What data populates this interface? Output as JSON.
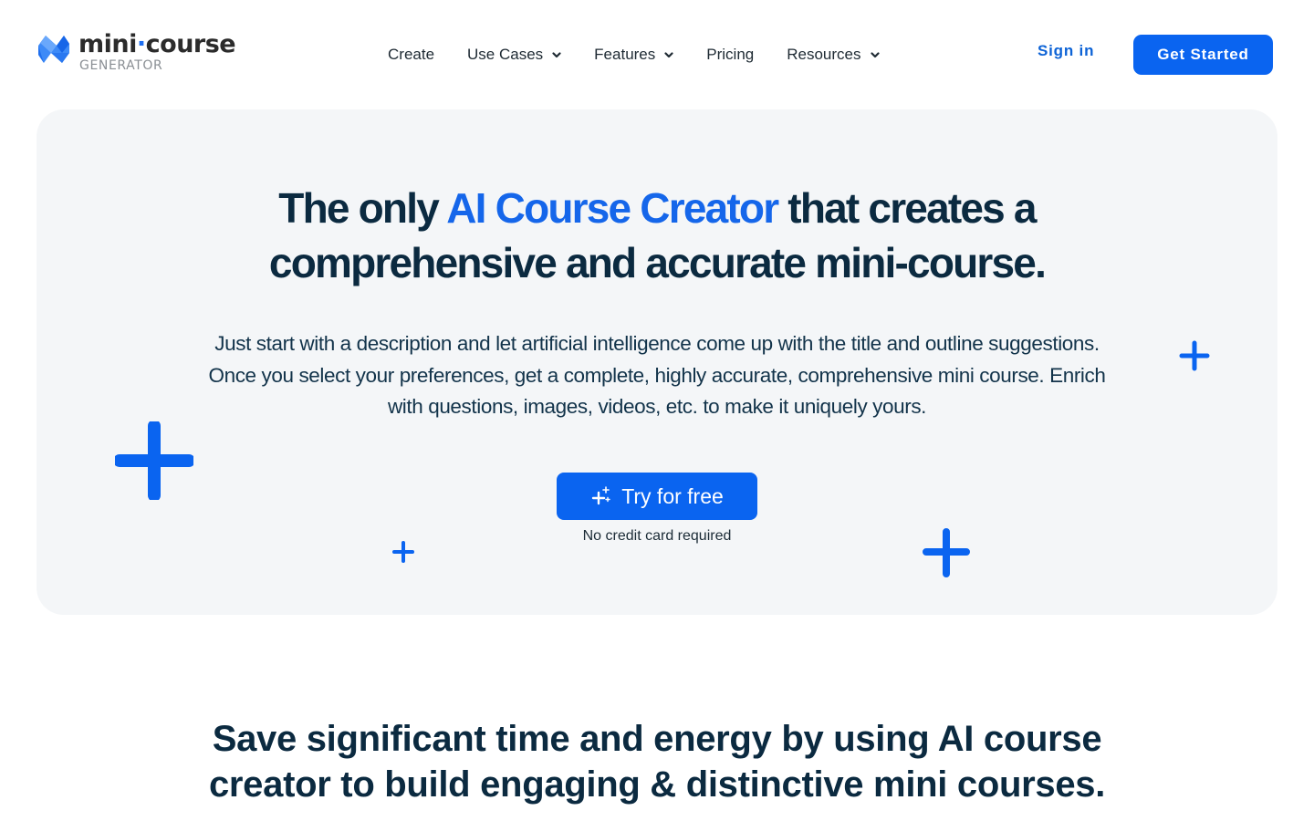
{
  "brand": {
    "name_part1": "mini",
    "name_dot": "·",
    "name_part2": "course",
    "subtitle": "GENERATOR",
    "logo_icon": "mini-course-logo-mark"
  },
  "nav": {
    "items": [
      {
        "label": "Create",
        "has_dropdown": false
      },
      {
        "label": "Use Cases",
        "has_dropdown": true
      },
      {
        "label": "Features",
        "has_dropdown": true
      },
      {
        "label": "Pricing",
        "has_dropdown": false
      },
      {
        "label": "Resources",
        "has_dropdown": true
      }
    ],
    "signin_label": "Sign in",
    "get_started_label": "Get Started"
  },
  "hero": {
    "title_prefix": "The only ",
    "title_accent": "AI Course Creator",
    "title_line1_suffix": " that creates a",
    "title_line2": "comprehensive and accurate mini-course.",
    "description": "Just start with a description and let artificial intelligence come up with the title and outline suggestions. Once you select your preferences, get a complete, highly accurate, comprehensive mini course. Enrich with questions, images, videos, etc. to make it uniquely yours.",
    "cta_label": "Try for free",
    "cta_icon": "sparkle-plus-icon",
    "cta_note": "No credit card required"
  },
  "section": {
    "title_line1": "Save significant time and energy by using AI course",
    "title_line2": "creator to build engaging & distinctive mini courses."
  },
  "colors": {
    "accent": "#0a64f0",
    "heading": "#0b2a40",
    "hero_bg": "#f4f6f8",
    "link": "#0d63d6"
  }
}
